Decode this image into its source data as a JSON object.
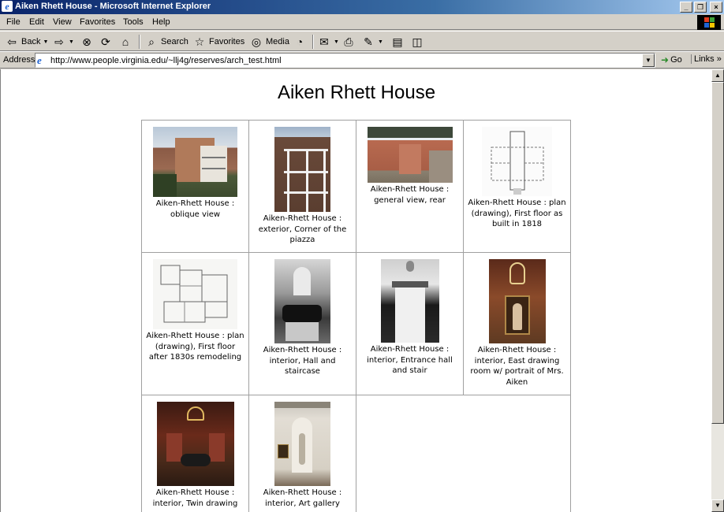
{
  "window": {
    "title": "Aiken Rhett House - Microsoft Internet Explorer",
    "buttons": {
      "minimize": "_",
      "maximize": "❐",
      "close": "×"
    }
  },
  "menu": [
    "File",
    "Edit",
    "View",
    "Favorites",
    "Tools",
    "Help"
  ],
  "toolbar": {
    "back": "Back",
    "search": "Search",
    "favorites": "Favorites",
    "media": "Media"
  },
  "address": {
    "label": "Address",
    "url": "http://www.people.virginia.edu/~llj4g/reserves/arch_test.html",
    "go": "Go",
    "links": "Links"
  },
  "page": {
    "heading": "Aiken Rhett House",
    "images": [
      {
        "caption": "Aiken-Rhett House : oblique view"
      },
      {
        "caption": "Aiken-Rhett House : exterior, Corner of the piazza"
      },
      {
        "caption": "Aiken-Rhett House : general view, rear"
      },
      {
        "caption": "Aiken-Rhett House : plan (drawing), First floor as built in 1818"
      },
      {
        "caption": "Aiken-Rhett House : plan (drawing), First floor after 1830s remodeling"
      },
      {
        "caption": "Aiken-Rhett House : interior, Hall and staircase"
      },
      {
        "caption": "Aiken-Rhett House : interior, Entrance hall and stair"
      },
      {
        "caption": "Aiken-Rhett House : interior, East drawing room w/ portrait of Mrs. Aiken"
      },
      {
        "caption": "Aiken-Rhett House : interior, Twin drawing"
      },
      {
        "caption": "Aiken-Rhett House : interior, Art gallery"
      }
    ]
  },
  "colors": {
    "titlebar_start": "#0a246a",
    "chrome": "#d4d0c8",
    "page_bg": "#ffffff",
    "cell_border": "#a0a0a0"
  }
}
